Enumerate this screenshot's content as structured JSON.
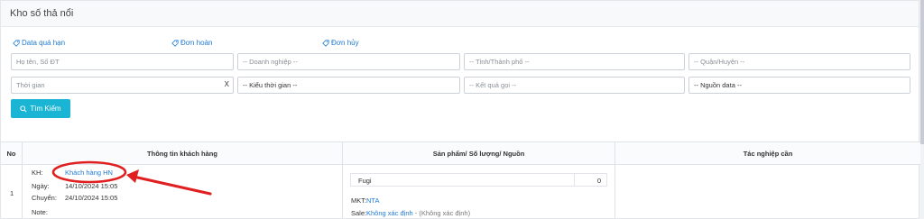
{
  "page": {
    "title": "Kho số thả nổi"
  },
  "quick_links": [
    {
      "label": "Data quá hạn"
    },
    {
      "label": "Đơn hoàn"
    },
    {
      "label": "Đơn hủy"
    }
  ],
  "filters": {
    "name_phone_placeholder": "Họ tên, Số ĐT",
    "company_placeholder": "-- Doanh nghiệp --",
    "province_placeholder": "-- Tỉnh/Thành phố --",
    "district_placeholder": "-- Quận/Huyện --",
    "time_placeholder": "Thời gian",
    "time_clear": "X",
    "time_type_placeholder": "-- Kiểu thời gian --",
    "call_result_placeholder": "-- Kết quả gọi --",
    "data_source_placeholder": "-- Nguồn data --"
  },
  "search_button": {
    "label": "Tìm Kiếm"
  },
  "table": {
    "headers": [
      "No",
      "Thông tin khách hàng",
      "Sản phẩm/ Số lượng/ Nguồn",
      "Tác nghiệp cần"
    ],
    "rows": [
      {
        "no": "1",
        "kh_label": "KH:",
        "kh_value": "Khách hàng HN",
        "date_label": "Ngày:",
        "date_value": "14/10/2024 15:05",
        "transfer_label": "Chuyển:",
        "transfer_value": "24/10/2024 15:05",
        "note_label": "Note:",
        "note_value": "",
        "product_name": "Fugi",
        "product_qty": "0",
        "mkt_label": "MKT:",
        "mkt_value": "NTA",
        "sale_label": "Sale:",
        "sale_value": "Không xác định",
        "sale_extra": " - (Không xác định)"
      }
    ]
  },
  "colors": {
    "accent": "#1ab5d4",
    "link": "#1e7bd6",
    "annotation": "#e02020"
  },
  "icons": [
    "tag-icon",
    "search-icon"
  ]
}
